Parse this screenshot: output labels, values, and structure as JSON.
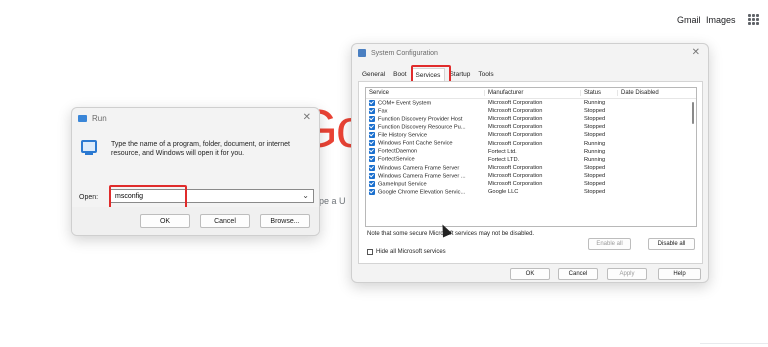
{
  "google": {
    "gmail": "Gmail",
    "images": "Images",
    "apps_icon": "apps-grid-icon",
    "logo_fragment": "Go",
    "search_fragment": "pe a U"
  },
  "run_dialog": {
    "title": "Run",
    "close": "✕",
    "description": "Type the name of a program, folder, document, or internet resource, and Windows will open it for you.",
    "open_label": "Open:",
    "open_value": "msconfig",
    "ok": "OK",
    "cancel": "Cancel",
    "browse": "Browse..."
  },
  "sysconfig": {
    "title": "System Configuration",
    "close": "✕",
    "tabs": [
      "General",
      "Boot",
      "Services",
      "Startup",
      "Tools"
    ],
    "active_tab": "Services",
    "columns": [
      "Service",
      "Manufacturer",
      "Status",
      "Date Disabled"
    ],
    "rows": [
      {
        "service": "COM+ Event System",
        "manufacturer": "Microsoft Corporation",
        "status": "Running"
      },
      {
        "service": "Fax",
        "manufacturer": "Microsoft Corporation",
        "status": "Stopped"
      },
      {
        "service": "Function Discovery Provider Host",
        "manufacturer": "Microsoft Corporation",
        "status": "Stopped"
      },
      {
        "service": "Function Discovery Resource Pu...",
        "manufacturer": "Microsoft Corporation",
        "status": "Stopped"
      },
      {
        "service": "File History Service",
        "manufacturer": "Microsoft Corporation",
        "status": "Stopped"
      },
      {
        "service": "Windows Font Cache Service",
        "manufacturer": "Microsoft Corporation",
        "status": "Running"
      },
      {
        "service": "FortectDaemon",
        "manufacturer": "Fortect Ltd.",
        "status": "Running"
      },
      {
        "service": "FortectService",
        "manufacturer": "Fortect LTD.",
        "status": "Running"
      },
      {
        "service": "Windows Camera Frame Server",
        "manufacturer": "Microsoft Corporation",
        "status": "Stopped"
      },
      {
        "service": "Windows Camera Frame Server ...",
        "manufacturer": "Microsoft Corporation",
        "status": "Stopped"
      },
      {
        "service": "GameInput Service",
        "manufacturer": "Microsoft Corporation",
        "status": "Stopped"
      },
      {
        "service": "Google Chrome Elevation Servic...",
        "manufacturer": "Google LLC",
        "status": "Stopped"
      }
    ],
    "note": "Note that some secure Microsoft services may not be disabled.",
    "enable_all": "Enable all",
    "disable_all": "Disable all",
    "hide_ms": "Hide all Microsoft services",
    "ok": "OK",
    "cancel": "Cancel",
    "apply": "Apply",
    "help": "Help"
  }
}
